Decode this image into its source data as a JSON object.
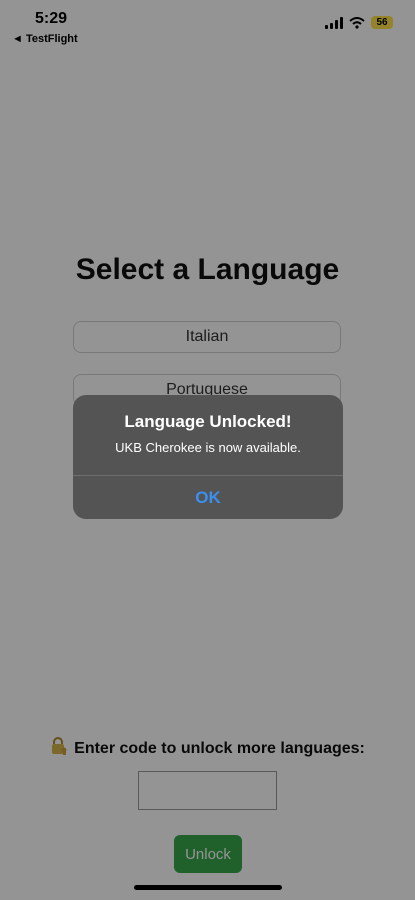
{
  "status_bar": {
    "time": "5:29",
    "back_app": "◄ TestFlight",
    "battery": "56"
  },
  "main": {
    "title": "Select a Language",
    "languages": [
      "Italian",
      "Portuguese"
    ],
    "unlock_prompt": "Enter code to unlock more languages:",
    "code_placeholder": "",
    "unlock_button": "Unlock"
  },
  "alert": {
    "title": "Language Unlocked!",
    "message": "UKB Cherokee is now available.",
    "ok_button": "OK"
  },
  "colors": {
    "unlock_green": "#37a64a",
    "alert_background": "#545454",
    "link_blue": "#3a8ff0",
    "battery_yellow": "#ffe24a"
  },
  "icons": [
    "signal-icon",
    "wifi-icon",
    "battery-icon",
    "lock-key-icon"
  ]
}
